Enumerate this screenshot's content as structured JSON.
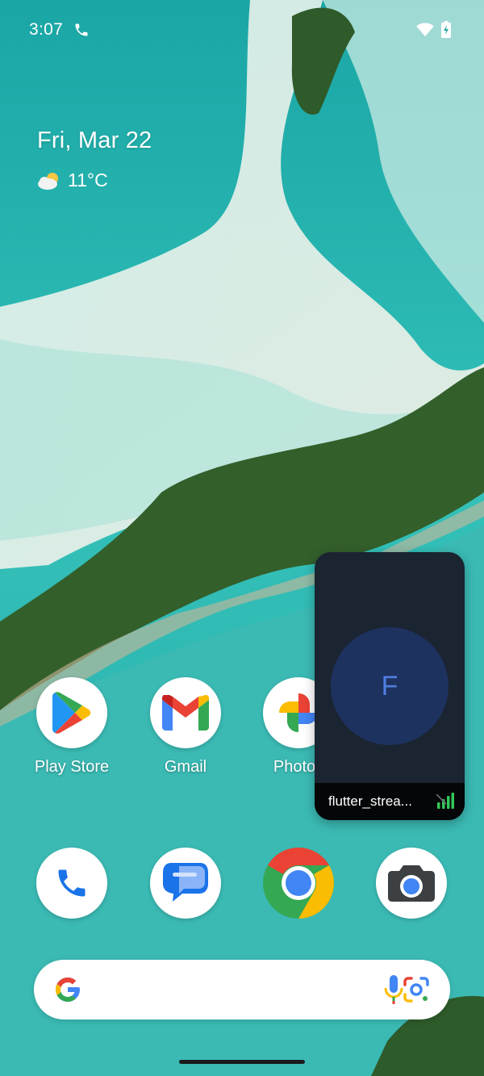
{
  "status_bar": {
    "time": "3:07"
  },
  "glance": {
    "date": "Fri, Mar 22",
    "temperature": "11°C",
    "weather_icon": "partly-cloudy-icon"
  },
  "apps": [
    {
      "label": "Play Store",
      "icon": "play-store-icon"
    },
    {
      "label": "Gmail",
      "icon": "gmail-icon"
    },
    {
      "label": "Photos",
      "icon": "photos-icon"
    }
  ],
  "dock": [
    {
      "icon": "phone-icon"
    },
    {
      "icon": "messages-icon"
    },
    {
      "icon": "chrome-icon"
    },
    {
      "icon": "camera-icon"
    }
  ],
  "bubble": {
    "initial": "F",
    "title": "flutter_strea..."
  },
  "colors": {
    "bubble_bg": "#1b2431",
    "avatar_bg": "#1e3260",
    "avatar_text": "#4f7fe0",
    "signal": "#34c759"
  }
}
